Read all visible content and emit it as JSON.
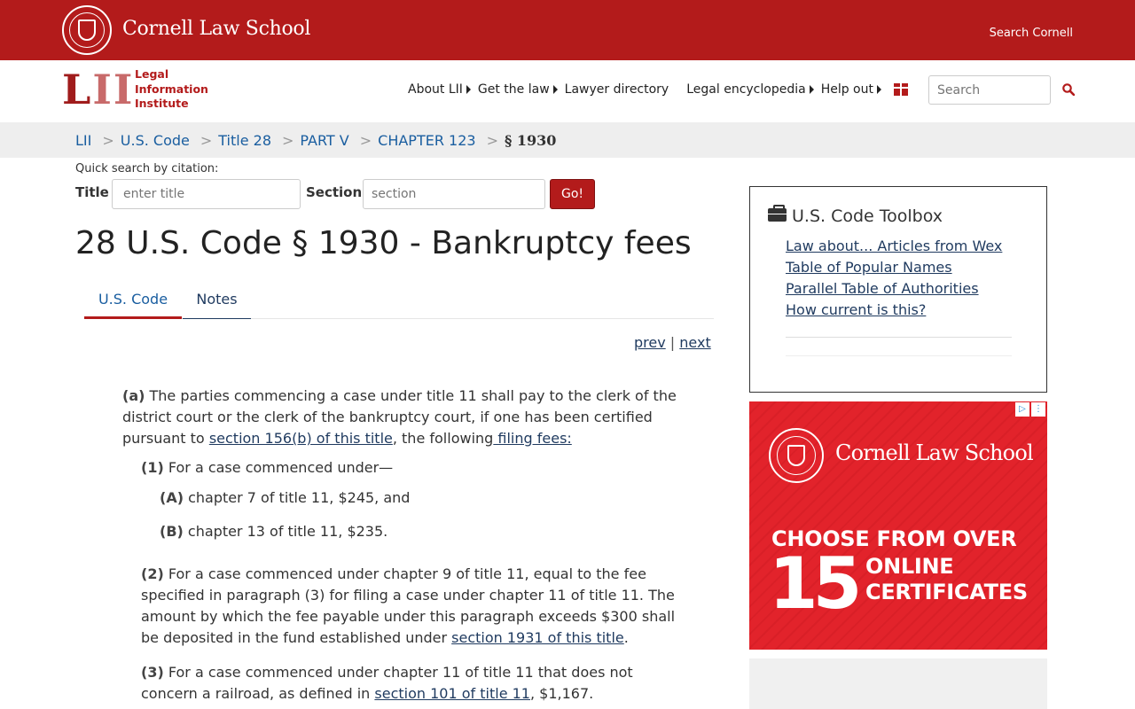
{
  "topbar": {
    "brand": "Cornell Law School",
    "search_link": "Search Cornell"
  },
  "header": {
    "logo_text_l": "L",
    "logo_text_ii": "II",
    "logo_sub_1": "Legal",
    "logo_sub_2": "Information",
    "logo_sub_3": "Institute",
    "nav": [
      {
        "label": "About LII"
      },
      {
        "label": "Get the law"
      },
      {
        "label": "Lawyer directory"
      },
      {
        "label": "Legal encyclopedia"
      },
      {
        "label": "Help out"
      }
    ],
    "search_placeholder": "Search"
  },
  "breadcrumb": {
    "items": [
      "LII",
      "U.S. Code",
      "Title 28",
      "PART V",
      "CHAPTER 123"
    ],
    "current": "§ 1930",
    "separator": ">"
  },
  "quick_search": {
    "label": "Quick search by citation:",
    "title_label": "Title",
    "title_placeholder": "enter title",
    "section_label": "Section",
    "section_placeholder": "section",
    "go_label": "Go!"
  },
  "page": {
    "title": "28 U.S. Code § 1930 - Bankruptcy fees",
    "tabs": [
      {
        "label": "U.S. Code"
      },
      {
        "label": "Notes"
      }
    ],
    "prev": "prev",
    "pipe": "|",
    "next": "next"
  },
  "content": {
    "a": {
      "marker": "(a)",
      "text1": " The parties commencing a case under title 11 shall pay to the clerk of the district court or the clerk of the bankruptcy court, if one has been certified pursuant to ",
      "link1": "section 156(b) of this title",
      "text2": ", the following",
      "link2": " filing fees:"
    },
    "p1": {
      "marker": "(1)",
      "text": " For a case commenced under—"
    },
    "pA": {
      "marker": "(A)",
      "text": " chapter 7 of title 11, $245, and"
    },
    "pB": {
      "marker": "(B)",
      "text": " chapter 13 of title 11, $235."
    },
    "p2": {
      "marker": "(2)",
      "text1": " For a case commenced under chapter 9 of title 11, equal to the fee specified in paragraph (3) for filing a case under chapter 11 of title 11. The amount by which the fee payable under this paragraph exceeds $300 shall be deposited in the fund established under ",
      "link1": "section 1931 of this title",
      "text2": "."
    },
    "p3": {
      "marker": "(3)",
      "text1": " For a case commenced under chapter 11 of title 11 that does not concern a railroad, as defined in ",
      "link1": "section 101 of title 11",
      "text2": ", $1,167."
    }
  },
  "toolbox": {
    "title": "U.S. Code Toolbox",
    "links": [
      {
        "label": "Law about... Articles from Wex"
      },
      {
        "label": "Table of Popular Names"
      },
      {
        "label": "Parallel Table of Authorities"
      },
      {
        "label": "How current is this?"
      }
    ]
  },
  "ad": {
    "brand": "Cornell Law School",
    "line1": "CHOOSE  FROM OVER",
    "number": "15",
    "line2": "ONLINE",
    "line3": "CERTIFICATES",
    "ctrl_play": "▷",
    "ctrl_more": "⋮"
  },
  "colors": {
    "cornell_red": "#b31b1b",
    "link_blue": "#1a5ea0",
    "link_dark": "#1f3a5f",
    "ad_red": "#e2232b"
  }
}
